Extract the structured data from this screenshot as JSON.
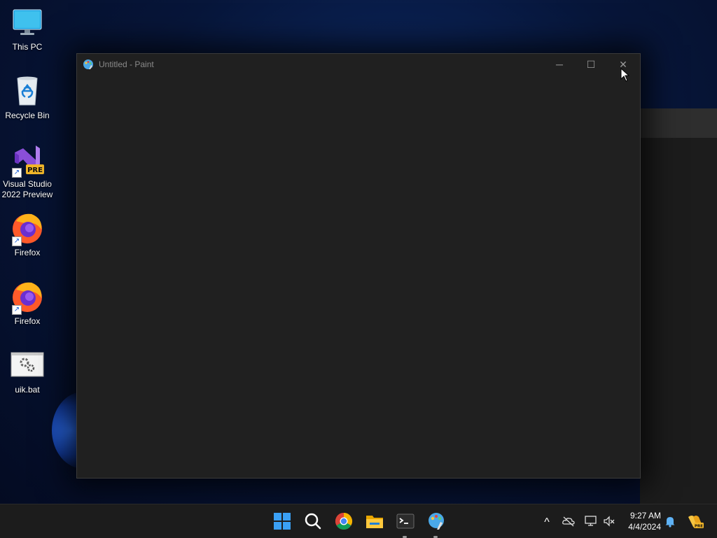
{
  "desktop": {
    "icons": [
      {
        "label": "This PC",
        "icon": "monitor-icon"
      },
      {
        "label": "Recycle Bin",
        "icon": "recycle-bin-icon"
      },
      {
        "label": "Visual Studio 2022 Preview",
        "label_line1": "Visual Studio",
        "label_line2": "2022 Preview",
        "icon": "visual-studio-icon",
        "badge": "PRE"
      },
      {
        "label": "Firefox",
        "icon": "firefox-icon"
      },
      {
        "label": "Firefox",
        "icon": "firefox-icon"
      },
      {
        "label": "uik.bat",
        "icon": "batch-file-icon"
      }
    ]
  },
  "window": {
    "title": "Untitled - Paint",
    "minimize_glyph": "─",
    "maximize_glyph": "☐",
    "close_glyph": "✕"
  },
  "taskbar": {
    "items": [
      {
        "name": "start",
        "icon": "windows-logo-icon"
      },
      {
        "name": "search",
        "icon": "search-icon"
      },
      {
        "name": "chrome",
        "icon": "chrome-icon"
      },
      {
        "name": "file-explorer",
        "icon": "folder-icon"
      },
      {
        "name": "terminal",
        "icon": "terminal-icon"
      },
      {
        "name": "paint",
        "icon": "paint-icon"
      }
    ],
    "tray": {
      "chevron_glyph": "^",
      "time": "9:27 AM",
      "date": "4/4/2024"
    }
  },
  "colors": {
    "accent": "#0078d4",
    "window_bg": "#202020",
    "taskbar_bg": "#1c1c1c"
  }
}
